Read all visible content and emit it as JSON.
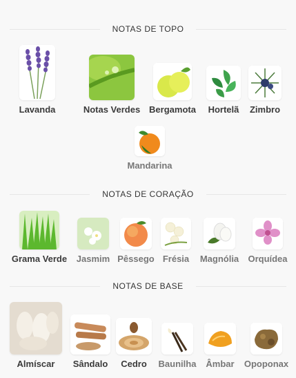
{
  "sections": {
    "top": {
      "title": "NOTAS DE TOPO",
      "notes": [
        {
          "name": "Lavanda",
          "icon": "lavender-image"
        },
        {
          "name": "Notas Verdes",
          "icon": "green-leaf-image"
        },
        {
          "name": "Bergamota",
          "icon": "bergamot-image"
        },
        {
          "name": "Hortelã",
          "icon": "mint-image"
        },
        {
          "name": "Zimbro",
          "icon": "juniper-image"
        },
        {
          "name": "Mandarina",
          "icon": "mandarin-image"
        }
      ]
    },
    "heart": {
      "title": "NOTAS DE CORAÇÃO",
      "notes": [
        {
          "name": "Grama Verde",
          "icon": "grass-image"
        },
        {
          "name": "Jasmim",
          "icon": "jasmine-image"
        },
        {
          "name": "Pêssego",
          "icon": "peach-image"
        },
        {
          "name": "Frésia",
          "icon": "freesia-image"
        },
        {
          "name": "Magnólia",
          "icon": "magnolia-image"
        },
        {
          "name": "Orquídea",
          "icon": "orchid-image"
        }
      ]
    },
    "base": {
      "title": "NOTAS DE BASE",
      "notes": [
        {
          "name": "Almíscar",
          "icon": "musk-image"
        },
        {
          "name": "Sândalo",
          "icon": "sandalwood-image"
        },
        {
          "name": "Cedro",
          "icon": "cedar-image"
        },
        {
          "name": "Baunilha",
          "icon": "vanilla-image"
        },
        {
          "name": "Âmbar",
          "icon": "amber-image"
        },
        {
          "name": "Opoponax",
          "icon": "opoponax-image"
        }
      ]
    }
  }
}
